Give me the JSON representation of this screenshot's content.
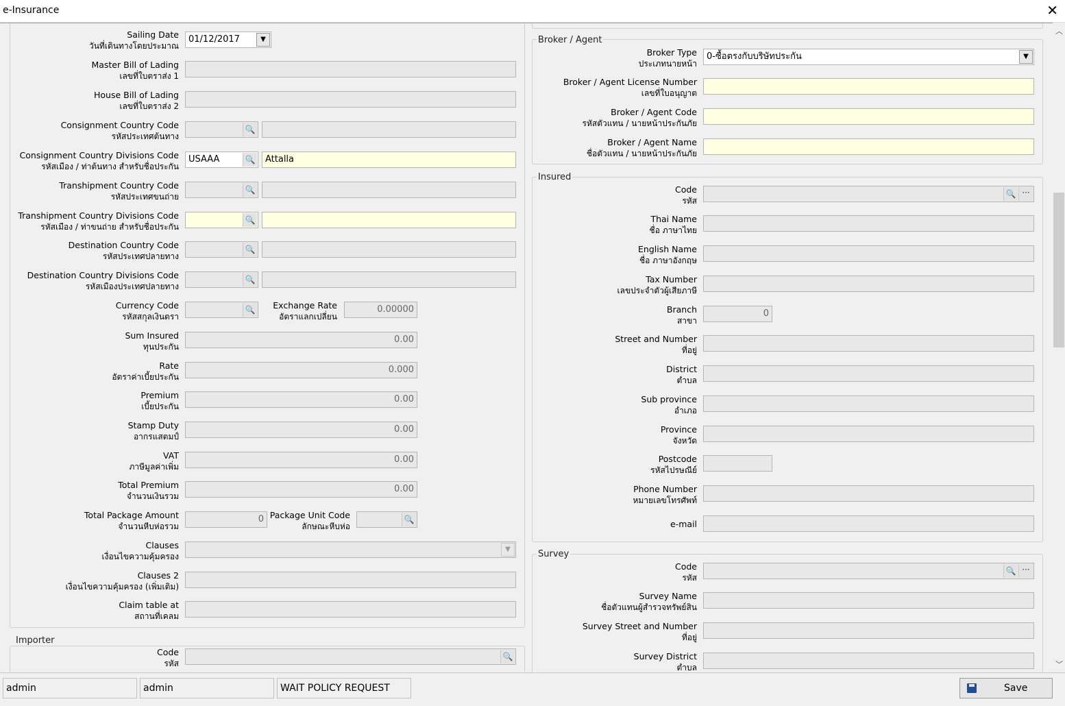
{
  "window": {
    "title": "e-Insurance",
    "close_glyph": "✕"
  },
  "left_form": {
    "sailing_date": {
      "label_en": "Sailing Date",
      "label_th": "วันที่เดินทางโดยประมาณ",
      "value": "01/12/2017"
    },
    "master_bl": {
      "label_en": "Master Bill of Lading",
      "label_th": "เลขที่ใบตราส่ง 1",
      "value": ""
    },
    "house_bl": {
      "label_en": "House Bill of Lading",
      "label_th": "เลขที่ใบตราส่ง 2",
      "value": ""
    },
    "consignment_country": {
      "label_en": "Consignment Country Code",
      "label_th": "รหัสประเทศต้นทาง",
      "code": "",
      "name": ""
    },
    "consignment_divisions": {
      "label_en": "Consignment Country Divisions Code",
      "label_th": "รหัสเมือง / ท่าต้นทาง สำหรับชื่อประกัน",
      "code": "USAAA",
      "name": "Attalla"
    },
    "transhipment_country": {
      "label_en": "Transhipment Country Code",
      "label_th": "รหัสประเทศขนถ่าย",
      "code": "",
      "name": ""
    },
    "transhipment_divisions": {
      "label_en": "Transhipment Country Divisions Code",
      "label_th": "รหัสเมือง / ท่าขนถ่าย สำหรับชื่อประกัน",
      "code": "",
      "name": ""
    },
    "destination_country": {
      "label_en": "Destination Country Code",
      "label_th": "รหัสประเทศปลายทาง",
      "code": "",
      "name": ""
    },
    "destination_divisions": {
      "label_en": "Destination Country Divisions Code",
      "label_th": "รหัสเมืองประเทศปลายทาง",
      "code": "",
      "name": ""
    },
    "currency": {
      "label_en": "Currency Code",
      "label_th": "รหัสสกุลเงินตรา",
      "code": ""
    },
    "exchange_rate": {
      "label_en": "Exchange Rate",
      "label_th": "อัตราแลกเปลี่ยน",
      "value": "0.00000"
    },
    "sum_insured": {
      "label_en": "Sum Insured",
      "label_th": "ทุนประกัน",
      "value": "0.00"
    },
    "rate": {
      "label_en": "Rate",
      "label_th": "อัตราค่าเบี้ยประกัน",
      "value": "0.000"
    },
    "premium": {
      "label_en": "Premium",
      "label_th": "เบี้ยประกัน",
      "value": "0.00"
    },
    "stamp_duty": {
      "label_en": "Stamp Duty",
      "label_th": "อากรแสตมป์",
      "value": "0.00"
    },
    "vat": {
      "label_en": "VAT",
      "label_th": "ภาษีมูลค่าเพิ่ม",
      "value": "0.00"
    },
    "total_premium": {
      "label_en": "Total Premium",
      "label_th": "จำนวนเงินรวม",
      "value": "0.00"
    },
    "total_package": {
      "label_en": "Total Package Amount",
      "label_th": "จำนวนหีบห่อรวม",
      "value": "0"
    },
    "package_unit": {
      "label_en": "Package Unit Code",
      "label_th": "ลักษณะหีบห่อ",
      "code": ""
    },
    "clauses": {
      "label_en": "Clauses",
      "label_th": "เงื่อนไขความคุ้มครอง",
      "value": ""
    },
    "clauses2": {
      "label_en": "Clauses 2",
      "label_th": "เงื่อนไขความคุ้มครอง (เพิ่มเติม)",
      "value": ""
    },
    "claim_table": {
      "label_en": "Claim table at",
      "label_th": "สถานที่เคลม",
      "value": ""
    }
  },
  "importer": {
    "title": "Importer",
    "code": {
      "label_en": "Code",
      "label_th": "รหัส",
      "value": ""
    }
  },
  "broker": {
    "title": "Broker / Agent",
    "type": {
      "label_en": "Broker Type",
      "label_th": "ประเภทนายหน้า",
      "value": "0-ซื้อตรงกับบริษัทประกัน"
    },
    "license": {
      "label_en": "Broker / Agent License Number",
      "label_th": "เลขที่ใบอนุญาต",
      "value": ""
    },
    "code": {
      "label_en": "Broker / Agent Code",
      "label_th": "รหัสตัวแทน / นายหน้าประกันภัย",
      "value": ""
    },
    "name": {
      "label_en": "Broker / Agent Name",
      "label_th": "ชื่อตัวแทน / นายหน้าประกันภัย",
      "value": ""
    }
  },
  "insured": {
    "title": "Insured",
    "code": {
      "label_en": "Code",
      "label_th": "รหัส",
      "value": ""
    },
    "thai_name": {
      "label_en": "Thai Name",
      "label_th": "ชื่อ ภาษาไทย",
      "value": ""
    },
    "english_name": {
      "label_en": "English Name",
      "label_th": "ชื่อ ภาษาอังกฤษ",
      "value": ""
    },
    "tax_number": {
      "label_en": "Tax Number",
      "label_th": "เลขประจำตัวผู้เสียภาษี",
      "value": ""
    },
    "branch": {
      "label_en": "Branch",
      "label_th": "สาขา",
      "value": "0"
    },
    "street": {
      "label_en": "Street and Number",
      "label_th": "ที่อยู่",
      "value": ""
    },
    "district": {
      "label_en": "District",
      "label_th": "ตำบล",
      "value": ""
    },
    "sub_province": {
      "label_en": "Sub province",
      "label_th": "อำเภอ",
      "value": ""
    },
    "province": {
      "label_en": "Province",
      "label_th": "จังหวัด",
      "value": ""
    },
    "postcode": {
      "label_en": "Postcode",
      "label_th": "รหัสไปรษณีย์",
      "value": ""
    },
    "phone": {
      "label_en": "Phone Number",
      "label_th": "หมายเลขโทรศัพท์",
      "value": ""
    },
    "email": {
      "label_en": "e-mail",
      "value": ""
    }
  },
  "survey": {
    "title": "Survey",
    "code": {
      "label_en": "Code",
      "label_th": "รหัส",
      "value": ""
    },
    "name": {
      "label_en": "Survey Name",
      "label_th": "ชื่อตัวแทนผู้สำรวจทรัพย์สิน",
      "value": ""
    },
    "street": {
      "label_en": "Survey Street and Number",
      "label_th": "ที่อยู่",
      "value": ""
    },
    "district": {
      "label_en": "Survey District",
      "label_th": "ตำบล",
      "value": ""
    }
  },
  "icons": {
    "lookup": "🔍",
    "ellipsis": "···",
    "dropdown": "▼",
    "scroll_up": "︿",
    "scroll_down": "﹀"
  },
  "status_bar": {
    "field1": "admin",
    "field2": "admin",
    "field3": "WAIT POLICY REQUEST",
    "save_label": "Save"
  }
}
